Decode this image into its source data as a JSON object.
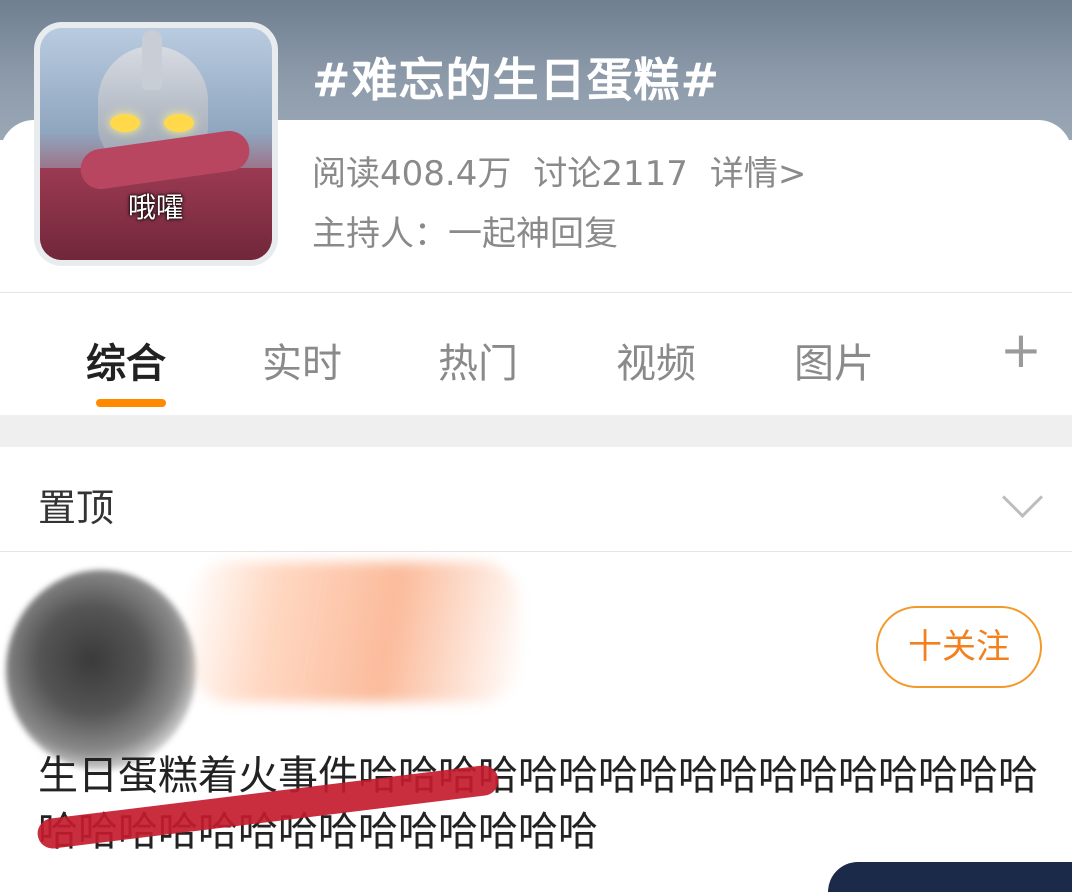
{
  "topic": {
    "avatar_caption": "哦嚯",
    "title": "#难忘的生日蛋糕#",
    "read_count": "阅读408.4万",
    "discussion_count": "讨论2117",
    "details_link": "详情>",
    "host": "主持人：一起神回复"
  },
  "tabs": [
    {
      "label": "综合",
      "active": true
    },
    {
      "label": "实时",
      "active": false
    },
    {
      "label": "热门",
      "active": false
    },
    {
      "label": "视频",
      "active": false
    },
    {
      "label": "图片",
      "active": false
    }
  ],
  "tabs_more_label": "+",
  "pinned": {
    "label": "置顶"
  },
  "post": {
    "follow_label": "十关注",
    "text": "生日蛋糕着火事件哈哈哈哈哈哈哈哈哈哈哈哈哈哈哈哈哈哈哈哈哈哈哈哈哈哈哈哈哈哈哈"
  },
  "colors": {
    "accent": "#ff8a00",
    "follow": "#f3801c",
    "muted_text": "#8a8a8a"
  }
}
